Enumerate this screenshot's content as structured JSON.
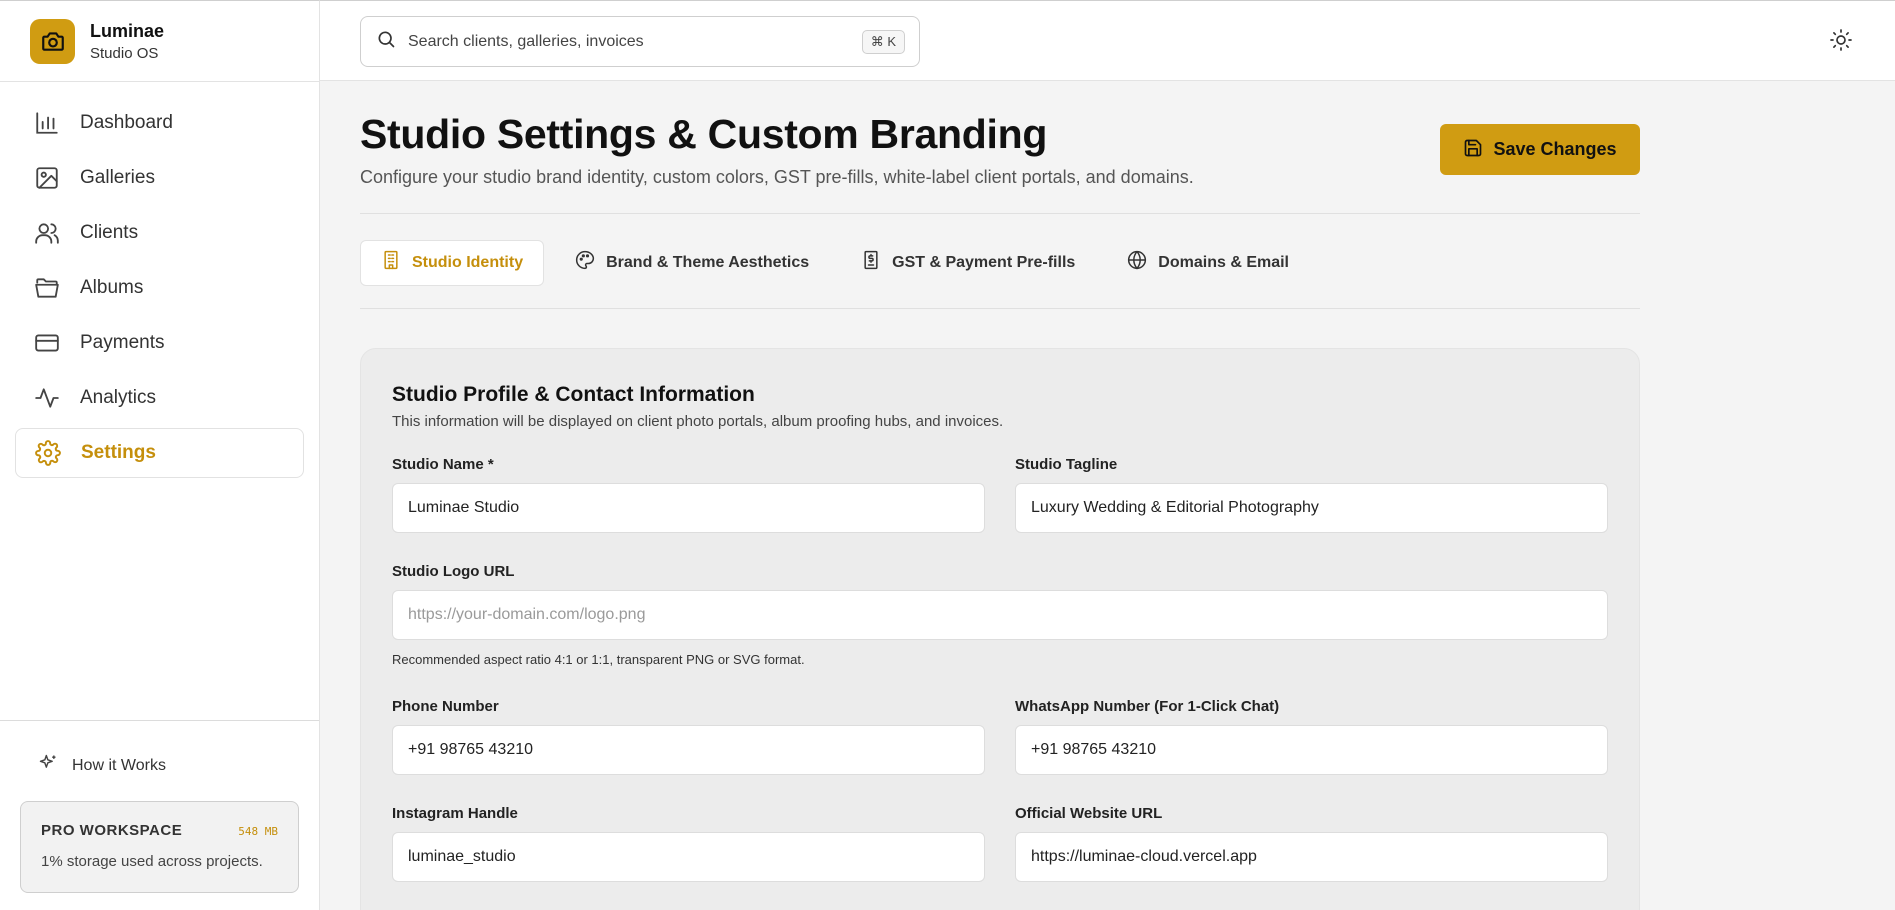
{
  "brand": {
    "name": "Luminae",
    "subtitle": "Studio OS"
  },
  "sidebar": {
    "items": [
      {
        "label": "Dashboard",
        "icon": "bar-chart-icon"
      },
      {
        "label": "Galleries",
        "icon": "image-icon"
      },
      {
        "label": "Clients",
        "icon": "users-icon"
      },
      {
        "label": "Albums",
        "icon": "folder-icon"
      },
      {
        "label": "Payments",
        "icon": "credit-card-icon"
      },
      {
        "label": "Analytics",
        "icon": "activity-icon"
      },
      {
        "label": "Settings",
        "icon": "gear-icon",
        "active": true
      }
    ],
    "how_it_works": "How it Works",
    "workspace": {
      "title": "PRO WORKSPACE",
      "size": "548 MB",
      "desc": "1% storage used across projects."
    }
  },
  "search": {
    "placeholder": "Search clients, galleries, invoices",
    "shortcut": "⌘ K"
  },
  "header": {
    "title": "Studio Settings & Custom Branding",
    "subtitle": "Configure your studio brand identity, custom colors, GST pre-fills, white-label client portals, and domains.",
    "save_label": "Save Changes"
  },
  "tabs": [
    {
      "label": "Studio Identity",
      "icon": "building-icon",
      "active": true
    },
    {
      "label": "Brand & Theme Aesthetics",
      "icon": "palette-icon"
    },
    {
      "label": "GST & Payment Pre-fills",
      "icon": "receipt-icon"
    },
    {
      "label": "Domains & Email",
      "icon": "globe-icon"
    }
  ],
  "profile": {
    "title": "Studio Profile & Contact Information",
    "description": "This information will be displayed on client photo portals, album proofing hubs, and invoices.",
    "studio_name": {
      "label": "Studio Name *",
      "value": "Luminae Studio"
    },
    "studio_tagline": {
      "label": "Studio Tagline",
      "value": "Luxury Wedding & Editorial Photography"
    },
    "logo_url": {
      "label": "Studio Logo URL",
      "placeholder": "https://your-domain.com/logo.png",
      "hint": "Recommended aspect ratio 4:1 or 1:1, transparent PNG or SVG format."
    },
    "phone": {
      "label": "Phone Number",
      "value": "+91 98765 43210"
    },
    "whatsapp": {
      "label": "WhatsApp Number (For 1-Click Chat)",
      "value": "+91 98765 43210"
    },
    "instagram": {
      "label": "Instagram Handle",
      "value": "luminae_studio"
    },
    "website": {
      "label": "Official Website URL",
      "value": "https://luminae-cloud.vercel.app"
    }
  },
  "colors": {
    "accent": "#d09c12",
    "accent_text": "#c58f0c"
  }
}
